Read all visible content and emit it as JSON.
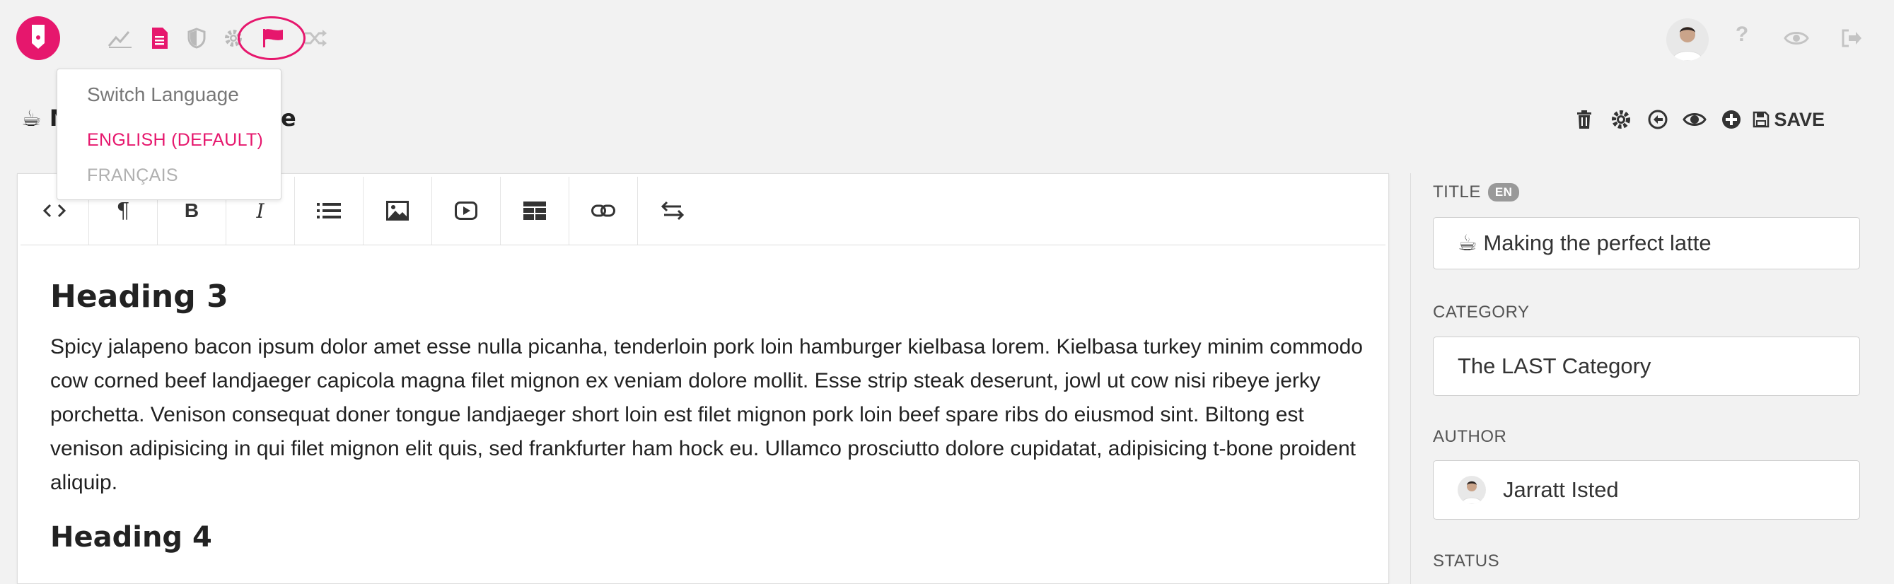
{
  "colors": {
    "accent": "#e6176d",
    "icon_gray": "#b9b9b9"
  },
  "topbar": {
    "logo": "logo-icon",
    "icons": [
      "chart-icon",
      "document-icon",
      "shield-icon",
      "gear-icon",
      "flag-icon",
      "shuffle-icon"
    ],
    "right_icons": [
      "avatar",
      "help-icon",
      "eye-icon",
      "logout-icon"
    ],
    "help_glyph": "?"
  },
  "page": {
    "title_emoji": "☕",
    "title_visible_start": "M",
    "title_visible_end": "e"
  },
  "actions": {
    "icons": [
      "trash-icon",
      "gear-icon",
      "back-icon",
      "preview-icon",
      "add-icon",
      "save-icon"
    ],
    "save_label": "SAVE"
  },
  "language_menu": {
    "header": "Switch Language",
    "options": [
      {
        "label": "ENGLISH (DEFAULT)",
        "active": true
      },
      {
        "label": "FRANÇAIS",
        "active": false
      }
    ]
  },
  "editor": {
    "toolbar": {
      "buttons": [
        "code-icon",
        "paragraph-icon",
        "bold-icon",
        "italic-icon",
        "list-icon",
        "image-icon",
        "video-icon",
        "table-icon",
        "link-icon",
        "swap-icon"
      ],
      "paragraph_glyph": "¶",
      "bold_glyph": "B",
      "italic_glyph": "I"
    },
    "heading3": "Heading 3",
    "paragraph": "Spicy jalapeno bacon ipsum dolor amet esse nulla picanha, tenderloin pork loin hamburger kielbasa lorem. Kielbasa turkey minim commodo cow corned beef landjaeger capicola magna filet mignon ex veniam dolore mollit. Esse strip steak deserunt, jowl ut cow nisi ribeye jerky porchetta. Venison consequat doner tongue landjaeger short loin est filet mignon pork loin beef spare ribs do eiusmod sint. Biltong est venison adipisicing in qui filet mignon elit quis, sed frankfurter ham hock eu. Ullamco prosciutto dolore cupidatat, adipisicing t-bone proident aliquip.",
    "heading4": "Heading 4"
  },
  "sidebar": {
    "title_label": "TITLE",
    "title_badge": "EN",
    "title_value": "☕ Making the perfect latte",
    "category_label": "CATEGORY",
    "category_value": "The LAST Category",
    "author_label": "AUTHOR",
    "author_value": "Jarratt Isted",
    "status_label": "STATUS"
  }
}
